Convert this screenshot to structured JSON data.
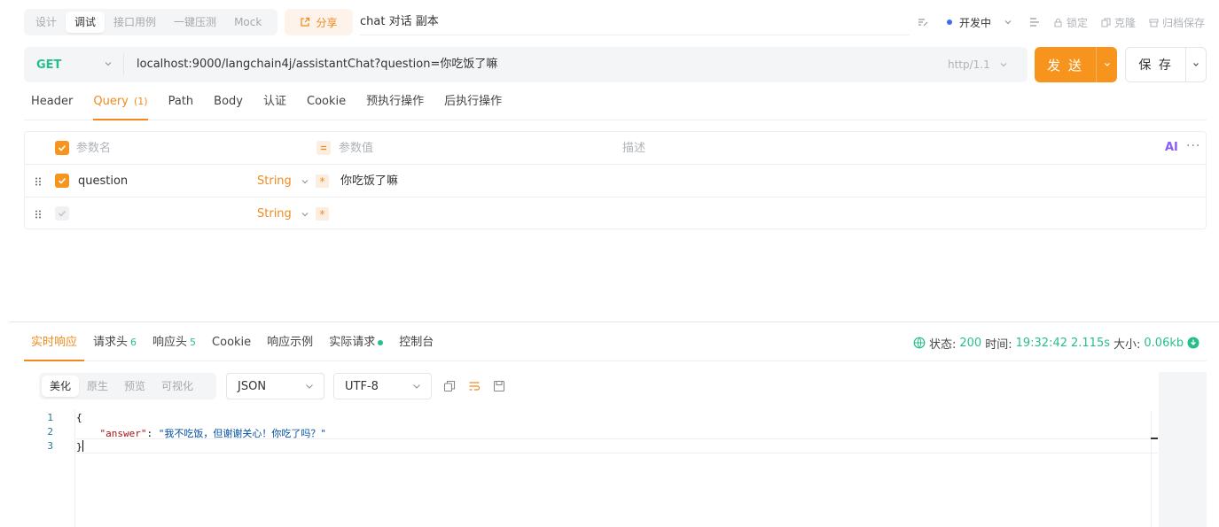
{
  "top_modes": [
    "设计",
    "调试",
    "接口用例",
    "一键压测",
    "Mock"
  ],
  "active_mode_index": 1,
  "share_label": "分享",
  "tab_title": "chat 对话 副本",
  "top_right": {
    "environment": "开发中",
    "lock": "锁定",
    "clone": "克隆",
    "archive": "归档保存"
  },
  "request": {
    "method": "GET",
    "url": "localhost:9000/langchain4j/assistantChat?question=你吃饭了嘛",
    "http_version": "http/1.1",
    "send_label": "发 送",
    "save_label": "保 存"
  },
  "request_tabs": [
    {
      "label": "Header",
      "count": ""
    },
    {
      "label": "Query",
      "count": "(1)"
    },
    {
      "label": "Path",
      "count": ""
    },
    {
      "label": "Body",
      "count": ""
    },
    {
      "label": "认证",
      "count": ""
    },
    {
      "label": "Cookie",
      "count": ""
    },
    {
      "label": "预执行操作",
      "count": ""
    },
    {
      "label": "后执行操作",
      "count": ""
    }
  ],
  "active_request_tab": 1,
  "params_table": {
    "headers": {
      "name": "参数名",
      "value": "参数值",
      "description": "描述"
    },
    "ai_label": "AI",
    "rows": [
      {
        "name": "question",
        "type": "String",
        "value": "你吃饭了嘛",
        "checked": true
      },
      {
        "name": "",
        "type": "String",
        "value": "",
        "checked": false
      }
    ]
  },
  "response_tabs": [
    {
      "label": "实时响应",
      "count": ""
    },
    {
      "label": "请求头",
      "count": "6"
    },
    {
      "label": "响应头",
      "count": "5"
    },
    {
      "label": "Cookie",
      "count": ""
    },
    {
      "label": "响应示例",
      "count": ""
    },
    {
      "label": "实际请求",
      "count": ""
    },
    {
      "label": "控制台",
      "count": ""
    }
  ],
  "active_response_tab": 0,
  "response_status": {
    "status_label": "状态:",
    "status_code": "200",
    "time_label": "时间:",
    "time": "19:32:42",
    "duration": "2.115s",
    "size_label": "大小:",
    "size": "0.06kb"
  },
  "viewer_modes": [
    "美化",
    "原生",
    "预览",
    "可视化"
  ],
  "active_viewer_mode": 0,
  "format_select": "JSON",
  "encoding_select": "UTF-8",
  "code": {
    "line_numbers": [
      "1",
      "2",
      "3"
    ],
    "line1": "{",
    "key": "\"answer\"",
    "colon": ": ",
    "value": "\"我不吃饭，但谢谢关心！你吃了吗？\"",
    "line3": "}"
  },
  "colors": {
    "accent": "#f7941d",
    "method_get": "#26bf8c",
    "status_ok": "#26bf8c"
  }
}
